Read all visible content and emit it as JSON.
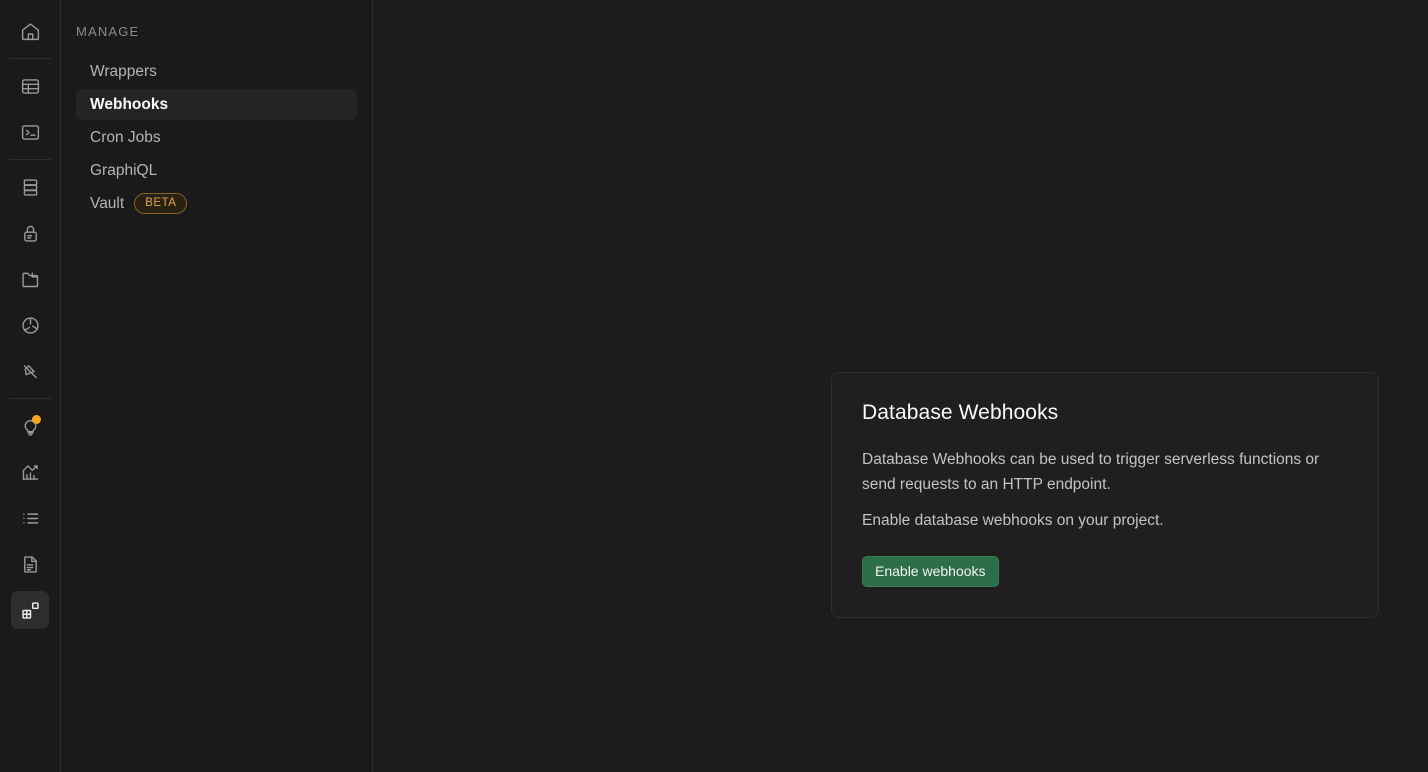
{
  "rail": {
    "groups": [
      {
        "items": [
          {
            "icon": "home-icon",
            "name": "rail-item-home",
            "active": false,
            "notification": false
          }
        ]
      },
      {
        "items": [
          {
            "icon": "table-editor-icon",
            "name": "rail-item-table-editor",
            "active": false,
            "notification": false
          },
          {
            "icon": "sql-editor-icon",
            "name": "rail-item-sql-editor",
            "active": false,
            "notification": false
          }
        ]
      },
      {
        "items": [
          {
            "icon": "database-icon",
            "name": "rail-item-database",
            "active": false,
            "notification": false
          },
          {
            "icon": "lock-icon",
            "name": "rail-item-authentication",
            "active": false,
            "notification": false
          },
          {
            "icon": "folder-icon",
            "name": "rail-item-storage",
            "active": false,
            "notification": false
          },
          {
            "icon": "edge-functions-icon",
            "name": "rail-item-edge-functions",
            "active": false,
            "notification": false
          },
          {
            "icon": "realtime-icon",
            "name": "rail-item-realtime",
            "active": false,
            "notification": false
          }
        ]
      },
      {
        "items": [
          {
            "icon": "lightbulb-icon",
            "name": "rail-item-advisors",
            "active": false,
            "notification": true
          },
          {
            "icon": "chart-icon",
            "name": "rail-item-reports",
            "active": false,
            "notification": false
          },
          {
            "icon": "list-icon",
            "name": "rail-item-logs",
            "active": false,
            "notification": false
          },
          {
            "icon": "document-icon",
            "name": "rail-item-api-docs",
            "active": false,
            "notification": false
          },
          {
            "icon": "integrations-icon",
            "name": "rail-item-integrations",
            "active": true,
            "notification": false
          }
        ]
      }
    ]
  },
  "sidebar": {
    "heading": "MANAGE",
    "items": [
      {
        "label": "Wrappers",
        "active": false,
        "badge": null
      },
      {
        "label": "Webhooks",
        "active": true,
        "badge": null
      },
      {
        "label": "Cron Jobs",
        "active": false,
        "badge": null
      },
      {
        "label": "GraphiQL",
        "active": false,
        "badge": null
      },
      {
        "label": "Vault",
        "active": false,
        "badge": "BETA"
      }
    ]
  },
  "card": {
    "title": "Database Webhooks",
    "description": "Database Webhooks can be used to trigger serverless functions or send requests to an HTTP endpoint.",
    "subtext": "Enable database webhooks on your project.",
    "button_label": "Enable webhooks"
  },
  "colors": {
    "accent_green": "#2b6e47",
    "badge_amber": "#e5a443",
    "notification_dot": "#f5a623",
    "page_bg": "#1c1c1c",
    "sidebar_bg": "#1a1a1a",
    "card_bg": "#1f1f1f"
  }
}
